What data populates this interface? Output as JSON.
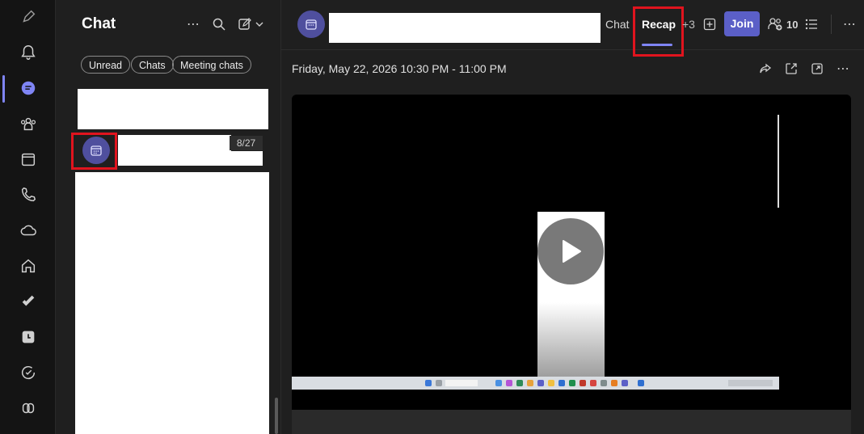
{
  "rail": {
    "icons": [
      "compose-icon",
      "bell-icon",
      "chat-icon",
      "teams-icon",
      "calendar-icon",
      "phone-icon",
      "cloud-icon",
      "home-icon",
      "planner-icon",
      "clock-icon",
      "approvals-icon",
      "copilot-icon"
    ]
  },
  "chatlist": {
    "title": "Chat",
    "filters": [
      "Unread",
      "Chats",
      "Meeting chats"
    ],
    "item_date": "8/27"
  },
  "header": {
    "tabs": {
      "chat": "Chat",
      "recap": "Recap",
      "more": "+3"
    },
    "join": "Join",
    "participants": "10"
  },
  "meeting": {
    "datetime": "Friday, May 22, 2026 10:30 PM - 11:00 PM"
  },
  "colors": {
    "accent": "#5b5fc7",
    "highlight": "#e0141e"
  }
}
